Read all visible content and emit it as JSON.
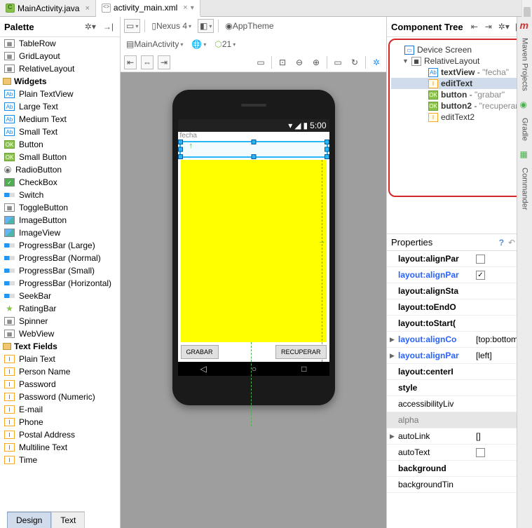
{
  "tabs": [
    {
      "label": "MainActivity.java",
      "icon": "java",
      "active": false
    },
    {
      "label": "activity_main.xml",
      "icon": "xml",
      "active": true
    }
  ],
  "palette": {
    "title": "Palette",
    "groups": [
      {
        "type": "item",
        "label": "TableRow",
        "icon": "layout"
      },
      {
        "type": "item",
        "label": "GridLayout",
        "icon": "layout"
      },
      {
        "type": "item",
        "label": "RelativeLayout",
        "icon": "layout"
      },
      {
        "type": "cat",
        "label": "Widgets"
      },
      {
        "type": "item",
        "label": "Plain TextView",
        "icon": "ab"
      },
      {
        "type": "item",
        "label": "Large Text",
        "icon": "ab"
      },
      {
        "type": "item",
        "label": "Medium Text",
        "icon": "ab"
      },
      {
        "type": "item",
        "label": "Small Text",
        "icon": "ab"
      },
      {
        "type": "item",
        "label": "Button",
        "icon": "ok"
      },
      {
        "type": "item",
        "label": "Small Button",
        "icon": "ok"
      },
      {
        "type": "item",
        "label": "RadioButton",
        "icon": "radio"
      },
      {
        "type": "item",
        "label": "CheckBox",
        "icon": "check"
      },
      {
        "type": "item",
        "label": "Switch",
        "icon": "bar"
      },
      {
        "type": "item",
        "label": "ToggleButton",
        "icon": "layout"
      },
      {
        "type": "item",
        "label": "ImageButton",
        "icon": "img"
      },
      {
        "type": "item",
        "label": "ImageView",
        "icon": "img"
      },
      {
        "type": "item",
        "label": "ProgressBar (Large)",
        "icon": "bar"
      },
      {
        "type": "item",
        "label": "ProgressBar (Normal)",
        "icon": "bar"
      },
      {
        "type": "item",
        "label": "ProgressBar (Small)",
        "icon": "bar"
      },
      {
        "type": "item",
        "label": "ProgressBar (Horizontal)",
        "icon": "bar"
      },
      {
        "type": "item",
        "label": "SeekBar",
        "icon": "bar"
      },
      {
        "type": "item",
        "label": "RatingBar",
        "icon": "star"
      },
      {
        "type": "item",
        "label": "Spinner",
        "icon": "layout"
      },
      {
        "type": "item",
        "label": "WebView",
        "icon": "layout"
      },
      {
        "type": "cat",
        "label": "Text Fields"
      },
      {
        "type": "item",
        "label": "Plain Text",
        "icon": "text"
      },
      {
        "type": "item",
        "label": "Person Name",
        "icon": "text"
      },
      {
        "type": "item",
        "label": "Password",
        "icon": "text"
      },
      {
        "type": "item",
        "label": "Password (Numeric)",
        "icon": "text"
      },
      {
        "type": "item",
        "label": "E-mail",
        "icon": "text"
      },
      {
        "type": "item",
        "label": "Phone",
        "icon": "text"
      },
      {
        "type": "item",
        "label": "Postal Address",
        "icon": "text"
      },
      {
        "type": "item",
        "label": "Multiline Text",
        "icon": "text"
      },
      {
        "type": "item",
        "label": "Time",
        "icon": "text"
      }
    ]
  },
  "designer": {
    "device_label": "Nexus 4",
    "theme_label": "AppTheme",
    "activity_label": "MainActivity",
    "api_label": "21",
    "status_time": "5:00",
    "fecha_label": "fecha",
    "btn_grabar": "GRABAR",
    "btn_recuperar": "RECUPERAR",
    "footer": {
      "design": "Design",
      "text": "Text"
    }
  },
  "component_tree": {
    "title": "Component Tree",
    "nodes": [
      {
        "indent": 0,
        "exp": "",
        "icon": "device",
        "label": "Device Screen",
        "quote": "",
        "sel": false
      },
      {
        "indent": 1,
        "exp": "▼",
        "icon": "layout",
        "label": "RelativeLayout",
        "quote": "",
        "sel": false
      },
      {
        "indent": 2,
        "exp": "",
        "icon": "ab",
        "label": "textView",
        "quote": "\"fecha\"",
        "sel": false
      },
      {
        "indent": 2,
        "exp": "",
        "icon": "ed",
        "label": "editText",
        "quote": "",
        "sel": true
      },
      {
        "indent": 2,
        "exp": "",
        "icon": "ok",
        "label": "button",
        "quote": "\"grabar\"",
        "sel": false
      },
      {
        "indent": 2,
        "exp": "",
        "icon": "ok",
        "label": "button2",
        "quote": "\"recuperar\"",
        "sel": false
      },
      {
        "indent": 2,
        "exp": "",
        "icon": "ed",
        "label": "editText2",
        "quote": "",
        "sel": false
      }
    ]
  },
  "properties": {
    "title": "Properties",
    "rows": [
      {
        "name": "layout:alignParentRight",
        "disp": "layout:alignPar",
        "val": "checkbox-off",
        "bold": true
      },
      {
        "name": "layout:alignParentEnd",
        "disp": "layout:alignPar",
        "val": "checkbox-on",
        "link": true
      },
      {
        "name": "layout:alignStart",
        "disp": "layout:alignSta",
        "val": "",
        "bold": true
      },
      {
        "name": "layout:toEndOf",
        "disp": "layout:toEndO",
        "val": "",
        "bold": true
      },
      {
        "name": "layout:toStartOf",
        "disp": "layout:toStart(",
        "val": "",
        "bold": true
      },
      {
        "name": "layout:alignComponent",
        "disp": "layout:alignCo",
        "val": "[top:bottom, rig...",
        "exp": "▶",
        "link": true
      },
      {
        "name": "layout:alignParent",
        "disp": "layout:alignPar",
        "val": "[left]",
        "exp": "▶",
        "link": true
      },
      {
        "name": "layout:centerInParent",
        "disp": "layout:centerI",
        "val": "",
        "bold": true
      },
      {
        "name": "style",
        "disp": "style",
        "val": "",
        "bold": true
      },
      {
        "name": "accessibilityLiveRegion",
        "disp": "accessibilityLiv",
        "val": ""
      },
      {
        "name": "alpha",
        "disp": "alpha",
        "val": "",
        "dim": true
      },
      {
        "name": "autoLink",
        "disp": "autoLink",
        "val": "[]",
        "exp": "▶"
      },
      {
        "name": "autoText",
        "disp": "autoText",
        "val": "checkbox-off"
      },
      {
        "name": "background",
        "disp": "background",
        "val": "",
        "bold": true
      },
      {
        "name": "backgroundTint",
        "disp": "backgroundTin",
        "val": ""
      }
    ]
  },
  "sidestrip": {
    "items": [
      {
        "label": "Maven Projects",
        "icon": "m"
      },
      {
        "label": "Gradle",
        "icon": "g"
      },
      {
        "label": "Commander",
        "icon": "c"
      }
    ]
  }
}
